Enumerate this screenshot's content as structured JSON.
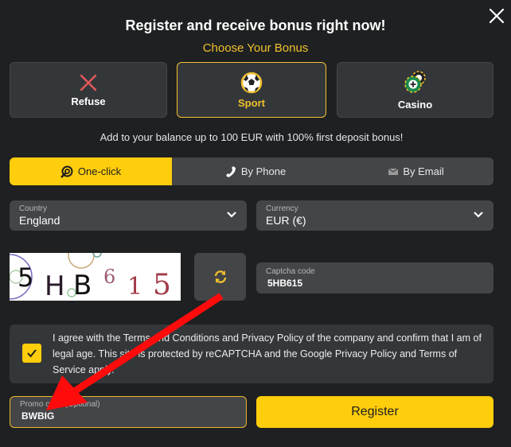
{
  "header": {
    "title": "Register and receive bonus right now!",
    "subtitle": "Choose Your Bonus",
    "close_icon": "close-icon"
  },
  "bonus_options": [
    {
      "label": "Refuse",
      "icon": "x-icon",
      "selected": false
    },
    {
      "label": "Sport",
      "icon": "soccer-ball-icon",
      "selected": true
    },
    {
      "label": "Casino",
      "icon": "casino-chips-icon",
      "selected": false
    }
  ],
  "info_text": "Add to your balance up to 100 EUR with 100% first deposit bonus!",
  "tabs": [
    {
      "label": "One-click",
      "icon": "one-click-icon",
      "active": true
    },
    {
      "label": "By Phone",
      "icon": "phone-icon",
      "active": false
    },
    {
      "label": "By Email",
      "icon": "email-icon",
      "active": false
    }
  ],
  "country": {
    "caption": "Country",
    "value": "England"
  },
  "currency": {
    "caption": "Currency",
    "value": "EUR (€)"
  },
  "captcha": {
    "image_text": [
      "5",
      "H",
      "B",
      "6",
      "1",
      "5"
    ],
    "refresh_icon": "refresh-icon",
    "caption": "Captcha code",
    "value": "5HB615"
  },
  "agreement": {
    "checked": true,
    "text": "I agree with the Terms and Conditions and Privacy Policy of the company and confirm that I am of legal age. This site is protected by reCAPTCHA and the Google Privacy Policy and Terms of Service apply."
  },
  "promo": {
    "caption": "Promo code (Optional)",
    "value": "BWBIG"
  },
  "register_label": "Register",
  "colors": {
    "accent": "#fecd0b",
    "background": "#1e2022",
    "panel": "#434547",
    "annotation_arrow": "#ff0000"
  }
}
